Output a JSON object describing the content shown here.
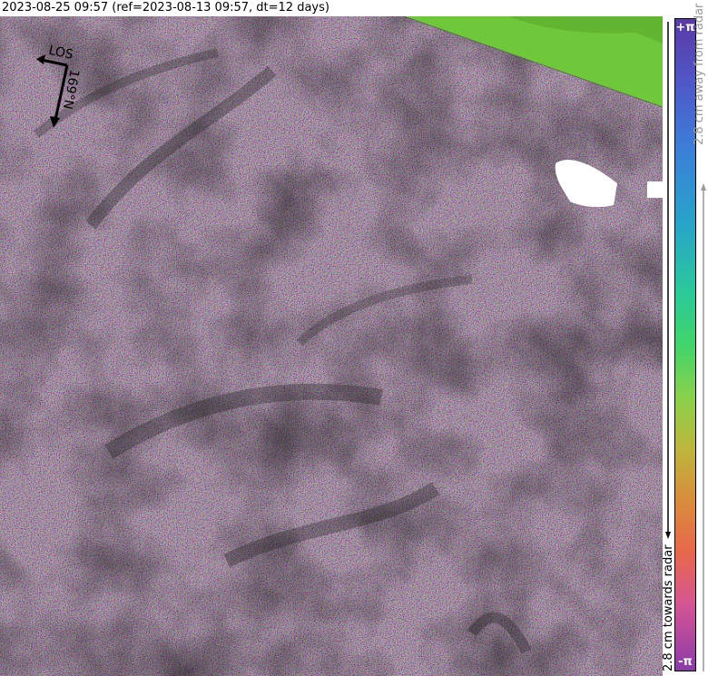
{
  "title": "2023-08-25 09:57 (ref=2023-08-13 09:57, dt=12 days)",
  "compass": {
    "los_label": "LOS",
    "heading_label": "169°N"
  },
  "colorbar": {
    "top_label": "+π",
    "bottom_label": "-π",
    "away_label": "2.8 cm away from radar",
    "towards_label": "2.8 cm towards radar",
    "colors": [
      "#5b3aa6",
      "#4f58c8",
      "#3b7fd8",
      "#27a6c8",
      "#2bc99a",
      "#41d46b",
      "#88d24b",
      "#bdb63c",
      "#d98c3c",
      "#e8674b",
      "#d45595",
      "#8a3aa9"
    ]
  },
  "map": {
    "noise_palette": [
      "#7a6bb0",
      "#5f9a7a",
      "#a87a6a",
      "#6a8f9e",
      "#9a6fa0",
      "#7f9a5a",
      "#8a8a8a",
      "#b06a8a"
    ],
    "no_data_color": "#ffffff",
    "outside_color": "#6fc83a"
  }
}
